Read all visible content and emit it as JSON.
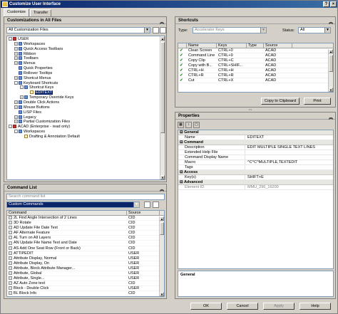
{
  "window": {
    "title": "Customize User Interface"
  },
  "tabs": [
    {
      "label": "Customize"
    },
    {
      "label": "Transfer"
    }
  ],
  "customizations": {
    "header": "Customizations in All Files",
    "filter": "All Customization Files",
    "tree": [
      {
        "label": "USER",
        "indent": 0,
        "icon": "red",
        "exp": "-"
      },
      {
        "label": "Workspaces",
        "indent": 1,
        "icon": "folder",
        "exp": "+"
      },
      {
        "label": "Quick Access Toolbars",
        "indent": 1,
        "icon": "folder",
        "exp": "+"
      },
      {
        "label": "Ribbon",
        "indent": 1,
        "icon": "folder",
        "exp": "+"
      },
      {
        "label": "Toolbars",
        "indent": 1,
        "icon": "folder",
        "exp": "+"
      },
      {
        "label": "Menus",
        "indent": 1,
        "icon": "folder",
        "exp": "+"
      },
      {
        "label": "Quick Properties",
        "indent": 1,
        "icon": "folder",
        "exp": ""
      },
      {
        "label": "Rollover Tooltips",
        "indent": 1,
        "icon": "folder",
        "exp": ""
      },
      {
        "label": "Shortcut Menus",
        "indent": 1,
        "icon": "folder",
        "exp": "+"
      },
      {
        "label": "Keyboard Shortcuts",
        "indent": 1,
        "icon": "folder",
        "exp": "-"
      },
      {
        "label": "Shortcut Keys",
        "indent": 2,
        "icon": "folder",
        "exp": "-"
      },
      {
        "label": "EDITEXT",
        "indent": 3,
        "icon": "doc",
        "exp": "",
        "selected": true
      },
      {
        "label": "Temporary Override Keys",
        "indent": 2,
        "icon": "folder",
        "exp": "+"
      },
      {
        "label": "Double Click Actions",
        "indent": 1,
        "icon": "folder",
        "exp": "+"
      },
      {
        "label": "Mouse Buttons",
        "indent": 1,
        "icon": "folder",
        "exp": "+"
      },
      {
        "label": "LISP Files",
        "indent": 1,
        "icon": "folder",
        "exp": ""
      },
      {
        "label": "Legacy",
        "indent": 1,
        "icon": "folder",
        "exp": "+"
      },
      {
        "label": "Partial Customization Files",
        "indent": 1,
        "icon": "folder",
        "exp": "+"
      },
      {
        "label": "ACAD (Enterprise - read only)",
        "indent": 0,
        "icon": "red",
        "exp": "-"
      },
      {
        "label": "Workspaces",
        "indent": 1,
        "icon": "folder",
        "exp": "-"
      },
      {
        "label": "Drafting & Annotation Default",
        "indent": 2,
        "icon": "doc",
        "exp": ""
      }
    ]
  },
  "commandList": {
    "header": "Command List",
    "search_placeholder": "Search command list",
    "filter": "Custom Commands",
    "columns": [
      "Command",
      "Source"
    ],
    "rows": [
      {
        "command": "2L  Find Angle Intersection of 2 Lines",
        "source": "CID"
      },
      {
        "command": "3D Rotate",
        "source": "CID"
      },
      {
        "command": "AD   Update File Date Text",
        "source": "CID"
      },
      {
        "command": "AF   Alternate Feature",
        "source": "CID"
      },
      {
        "command": "AL   Turn on All Layers",
        "source": "CID"
      },
      {
        "command": "AN   Update File Name Text and Date",
        "source": "CID"
      },
      {
        "command": "AS   Add One Seat Row (Front or Back)",
        "source": "CID"
      },
      {
        "command": "ATTIPEDIT",
        "source": "USER"
      },
      {
        "command": "Attribute Display, Normal",
        "source": "USER"
      },
      {
        "command": "Attribute Display, On",
        "source": "USER"
      },
      {
        "command": "Attribute, Block Attribute Manager...",
        "source": "USER"
      },
      {
        "command": "Attribute, Global",
        "source": "USER"
      },
      {
        "command": "Attribute, Single...",
        "source": "USER"
      },
      {
        "command": "AZ  Auto Zone text",
        "source": "CID"
      },
      {
        "command": "Block - Double Click",
        "source": "USER"
      },
      {
        "command": "BL   Block Info",
        "source": "CID"
      }
    ]
  },
  "shortcuts": {
    "header": "Shortcuts",
    "type_label": "Type:",
    "type_value": "Accelerator Keys",
    "status_label": "Status:",
    "status_value": "All",
    "columns": [
      "Name",
      "Keys",
      "Type",
      "Source"
    ],
    "rows": [
      {
        "name": "Clean Screen",
        "keys": "CTRL+0",
        "type": "",
        "source": "ACAD"
      },
      {
        "name": "Command Line",
        "keys": "CTRL+9",
        "type": "",
        "source": "ACAD"
      },
      {
        "name": "Copy Clip",
        "keys": "CTRL+C",
        "type": "",
        "source": "ACAD"
      },
      {
        "name": "Copy with B...",
        "keys": "CTRL+SHIF...",
        "type": "",
        "source": "ACAD"
      },
      {
        "name": "CTRL+H",
        "keys": "CTRL+H",
        "type": "",
        "source": "ACAD"
      },
      {
        "name": "CTRL+R",
        "keys": "CTRL+R",
        "type": "",
        "source": "ACAD"
      },
      {
        "name": "Cut",
        "keys": "CTRL+X",
        "type": "",
        "source": "ACAD"
      }
    ],
    "copy_button": "Copy to Clipboard",
    "print_button": "Print"
  },
  "properties": {
    "header": "Properties",
    "categories": [
      {
        "name": "General",
        "rows": [
          {
            "k": "Name",
            "v": "EDITEXT"
          }
        ]
      },
      {
        "name": "Command",
        "rows": [
          {
            "k": "Description",
            "v": "EDIT MULTIPLE SINGLE TEXT LINES"
          },
          {
            "k": "Extended Help File",
            "v": ""
          },
          {
            "k": "Command Display Name",
            "v": ""
          },
          {
            "k": "Macro",
            "v": "^C^C^MULTIPLE,TEXTEDIT"
          },
          {
            "k": "Tags",
            "v": ""
          }
        ]
      },
      {
        "name": "Access",
        "rows": [
          {
            "k": "Key(s)",
            "v": "SHIFT+E"
          }
        ]
      },
      {
        "name": "Advanced",
        "rows": [
          {
            "k": "Element ID",
            "v": "MMU_296_16200"
          }
        ]
      }
    ],
    "footer": "General"
  },
  "buttons": {
    "ok": "OK",
    "cancel": "Cancel",
    "apply": "Apply",
    "help": "Help"
  }
}
